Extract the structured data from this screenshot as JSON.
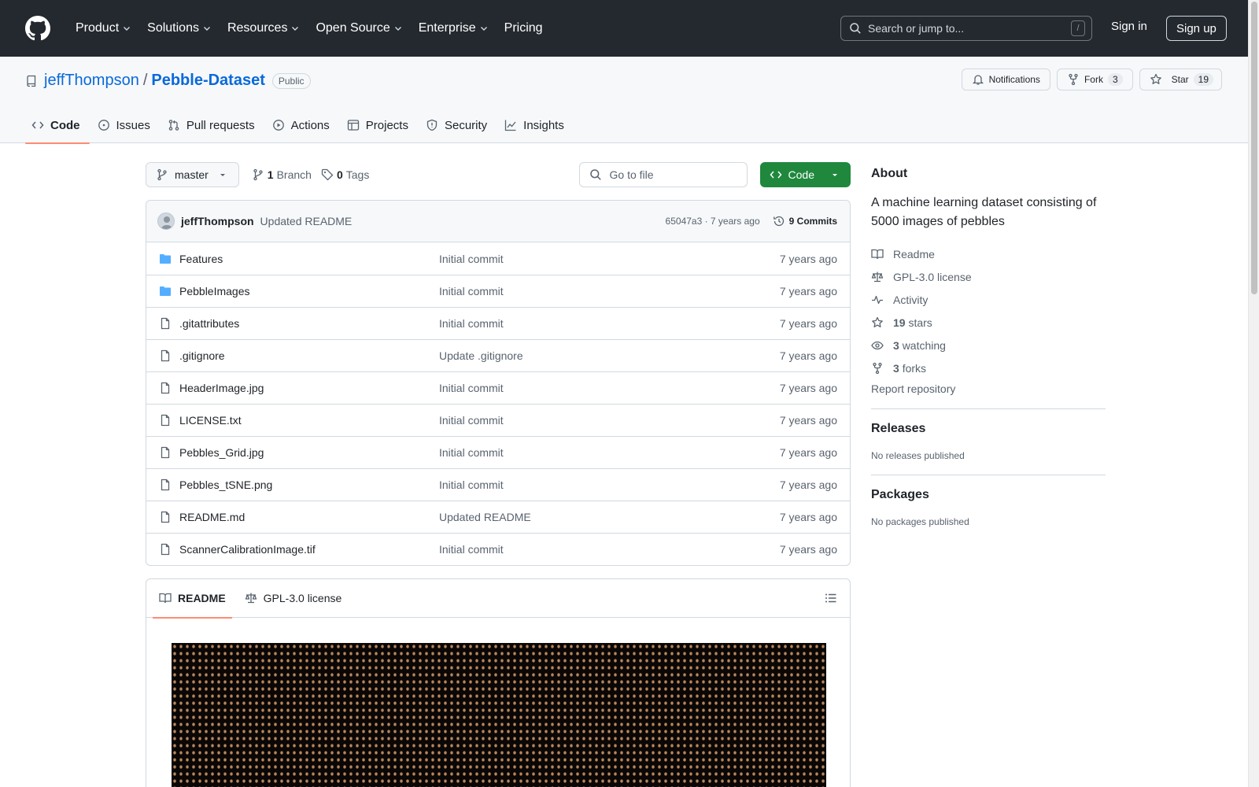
{
  "header": {
    "nav": [
      {
        "label": "Product"
      },
      {
        "label": "Solutions"
      },
      {
        "label": "Resources"
      },
      {
        "label": "Open Source"
      },
      {
        "label": "Enterprise"
      },
      {
        "label": "Pricing"
      }
    ],
    "search_placeholder": "Search or jump to...",
    "search_key": "/",
    "sign_in": "Sign in",
    "sign_up": "Sign up"
  },
  "repo": {
    "owner": "jeffThompson",
    "separator": "/",
    "name": "Pebble-Dataset",
    "visibility": "Public",
    "notifications_label": "Notifications",
    "fork_label": "Fork",
    "fork_count": "3",
    "star_label": "Star",
    "star_count": "19",
    "tabs": [
      {
        "label": "Code",
        "icon": "code-icon"
      },
      {
        "label": "Issues",
        "icon": "issue-icon"
      },
      {
        "label": "Pull requests",
        "icon": "pull-request-icon"
      },
      {
        "label": "Actions",
        "icon": "play-icon"
      },
      {
        "label": "Projects",
        "icon": "table-icon"
      },
      {
        "label": "Security",
        "icon": "shield-icon"
      },
      {
        "label": "Insights",
        "icon": "graph-icon"
      }
    ]
  },
  "toolbar": {
    "branch": "master",
    "branch_count": "1",
    "branch_label": "Branch",
    "tag_count": "0",
    "tag_label": "Tags",
    "goto_placeholder": "Go to file",
    "code_button": "Code"
  },
  "latest_commit": {
    "author": "jeffThompson",
    "message": "Updated README",
    "meta": "65047a3 · 7 years ago",
    "commits": "9 Commits"
  },
  "files": [
    {
      "name": "Features",
      "type": "folder",
      "message": "Initial commit",
      "date": "7 years ago"
    },
    {
      "name": "PebbleImages",
      "type": "folder",
      "message": "Initial commit",
      "date": "7 years ago"
    },
    {
      "name": ".gitattributes",
      "type": "file",
      "message": "Initial commit",
      "date": "7 years ago"
    },
    {
      "name": ".gitignore",
      "type": "file",
      "message": "Update .gitignore",
      "date": "7 years ago"
    },
    {
      "name": "HeaderImage.jpg",
      "type": "file",
      "message": "Initial commit",
      "date": "7 years ago"
    },
    {
      "name": "LICENSE.txt",
      "type": "file",
      "message": "Initial commit",
      "date": "7 years ago"
    },
    {
      "name": "Pebbles_Grid.jpg",
      "type": "file",
      "message": "Initial commit",
      "date": "7 years ago"
    },
    {
      "name": "Pebbles_tSNE.png",
      "type": "file",
      "message": "Initial commit",
      "date": "7 years ago"
    },
    {
      "name": "README.md",
      "type": "file",
      "message": "Updated README",
      "date": "7 years ago"
    },
    {
      "name": "ScannerCalibrationImage.tif",
      "type": "file",
      "message": "Initial commit",
      "date": "7 years ago"
    }
  ],
  "readme": {
    "tab_readme": "README",
    "tab_license": "GPL-3.0 license"
  },
  "about": {
    "title": "About",
    "description": "A machine learning dataset consisting of 5000 images of pebbles",
    "readme": "Readme",
    "license": "GPL-3.0 license",
    "activity": "Activity",
    "stars_count": "19",
    "stars_label": "stars",
    "watching_count": "3",
    "watching_label": "watching",
    "forks_count": "3",
    "forks_label": "forks",
    "report": "Report repository"
  },
  "releases": {
    "title": "Releases",
    "note": "No releases published"
  },
  "packages": {
    "title": "Packages",
    "note": "No packages published"
  },
  "colors": {
    "header_bg": "#24292f",
    "accent": "#0969da",
    "code_button": "#1f883d",
    "tab_underline": "#fd8c73",
    "folder": "#54aeff"
  }
}
